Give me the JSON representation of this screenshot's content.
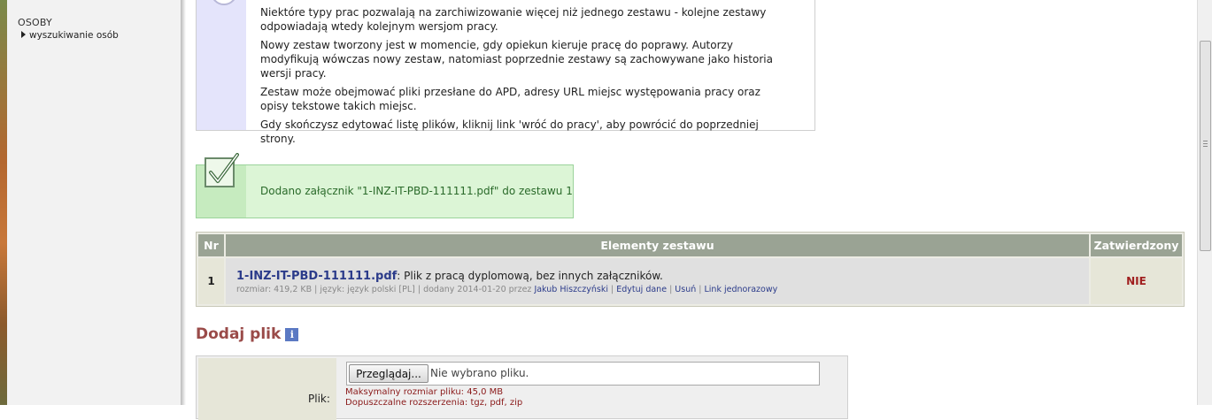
{
  "sidebar": {
    "heading": "OSOBY",
    "link": "wyszukiwanie osób"
  },
  "info": {
    "paragraphs": [
      "Niektóre typy prac pozwalają na zarchiwizowanie więcej niż jednego zestawu - kolejne zestawy odpowiadają wtedy kolejnym wersjom pracy.",
      "Nowy zestaw tworzony jest w momencie, gdy opiekun kieruje pracę do poprawy. Autorzy modyfikują wówczas nowy zestaw, natomiast poprzednie zestawy są zachowywane jako historia wersji pracy.",
      "Zestaw może obejmować pliki przesłane do APD, adresy URL miejsc występowania pracy oraz opisy tekstowe takich miejsc.",
      "Gdy skończysz edytować listę plików, kliknij link 'wróć do pracy', aby powrócić do poprzedniej strony."
    ]
  },
  "success": {
    "message": "Dodano załącznik \"1-INZ-IT-PBD-111111.pdf\" do zestawu 1"
  },
  "table": {
    "headers": {
      "nr": "Nr",
      "elements": "Elementy zestawu",
      "approved": "Zatwierdzony"
    },
    "rows": [
      {
        "nr": "1",
        "file_name": "1-INZ-IT-PBD-111111.pdf",
        "description": ": Plik z pracą dyplomową, bez innych załączników.",
        "meta": "rozmiar: 419,2 KB | język: język polski [PL] | dodany 2014-01-20 przez ",
        "author": "Jakub Hiszczyński",
        "sep": " | ",
        "edit": "Edytuj dane",
        "delete": "Usuń",
        "onetime": "Link jednorazowy",
        "approved": "NIE"
      }
    ]
  },
  "add_file": {
    "title": "Dodaj plik",
    "info_icon": "i",
    "label": "Plik:",
    "browse_label": "Przeglądaj...",
    "no_file": "Nie wybrano pliku.",
    "max_size": "Maksymalny rozmiar pliku: 45,0 MB",
    "extensions": "Dopuszczalne rozszerzenia: tgz, pdf, zip"
  },
  "colors": {
    "title_accent": "#9a4b49",
    "success_bg": "#dcf5d6",
    "header_bg": "#9aa394",
    "link": "#2b3b8a",
    "negative": "#a02020"
  }
}
